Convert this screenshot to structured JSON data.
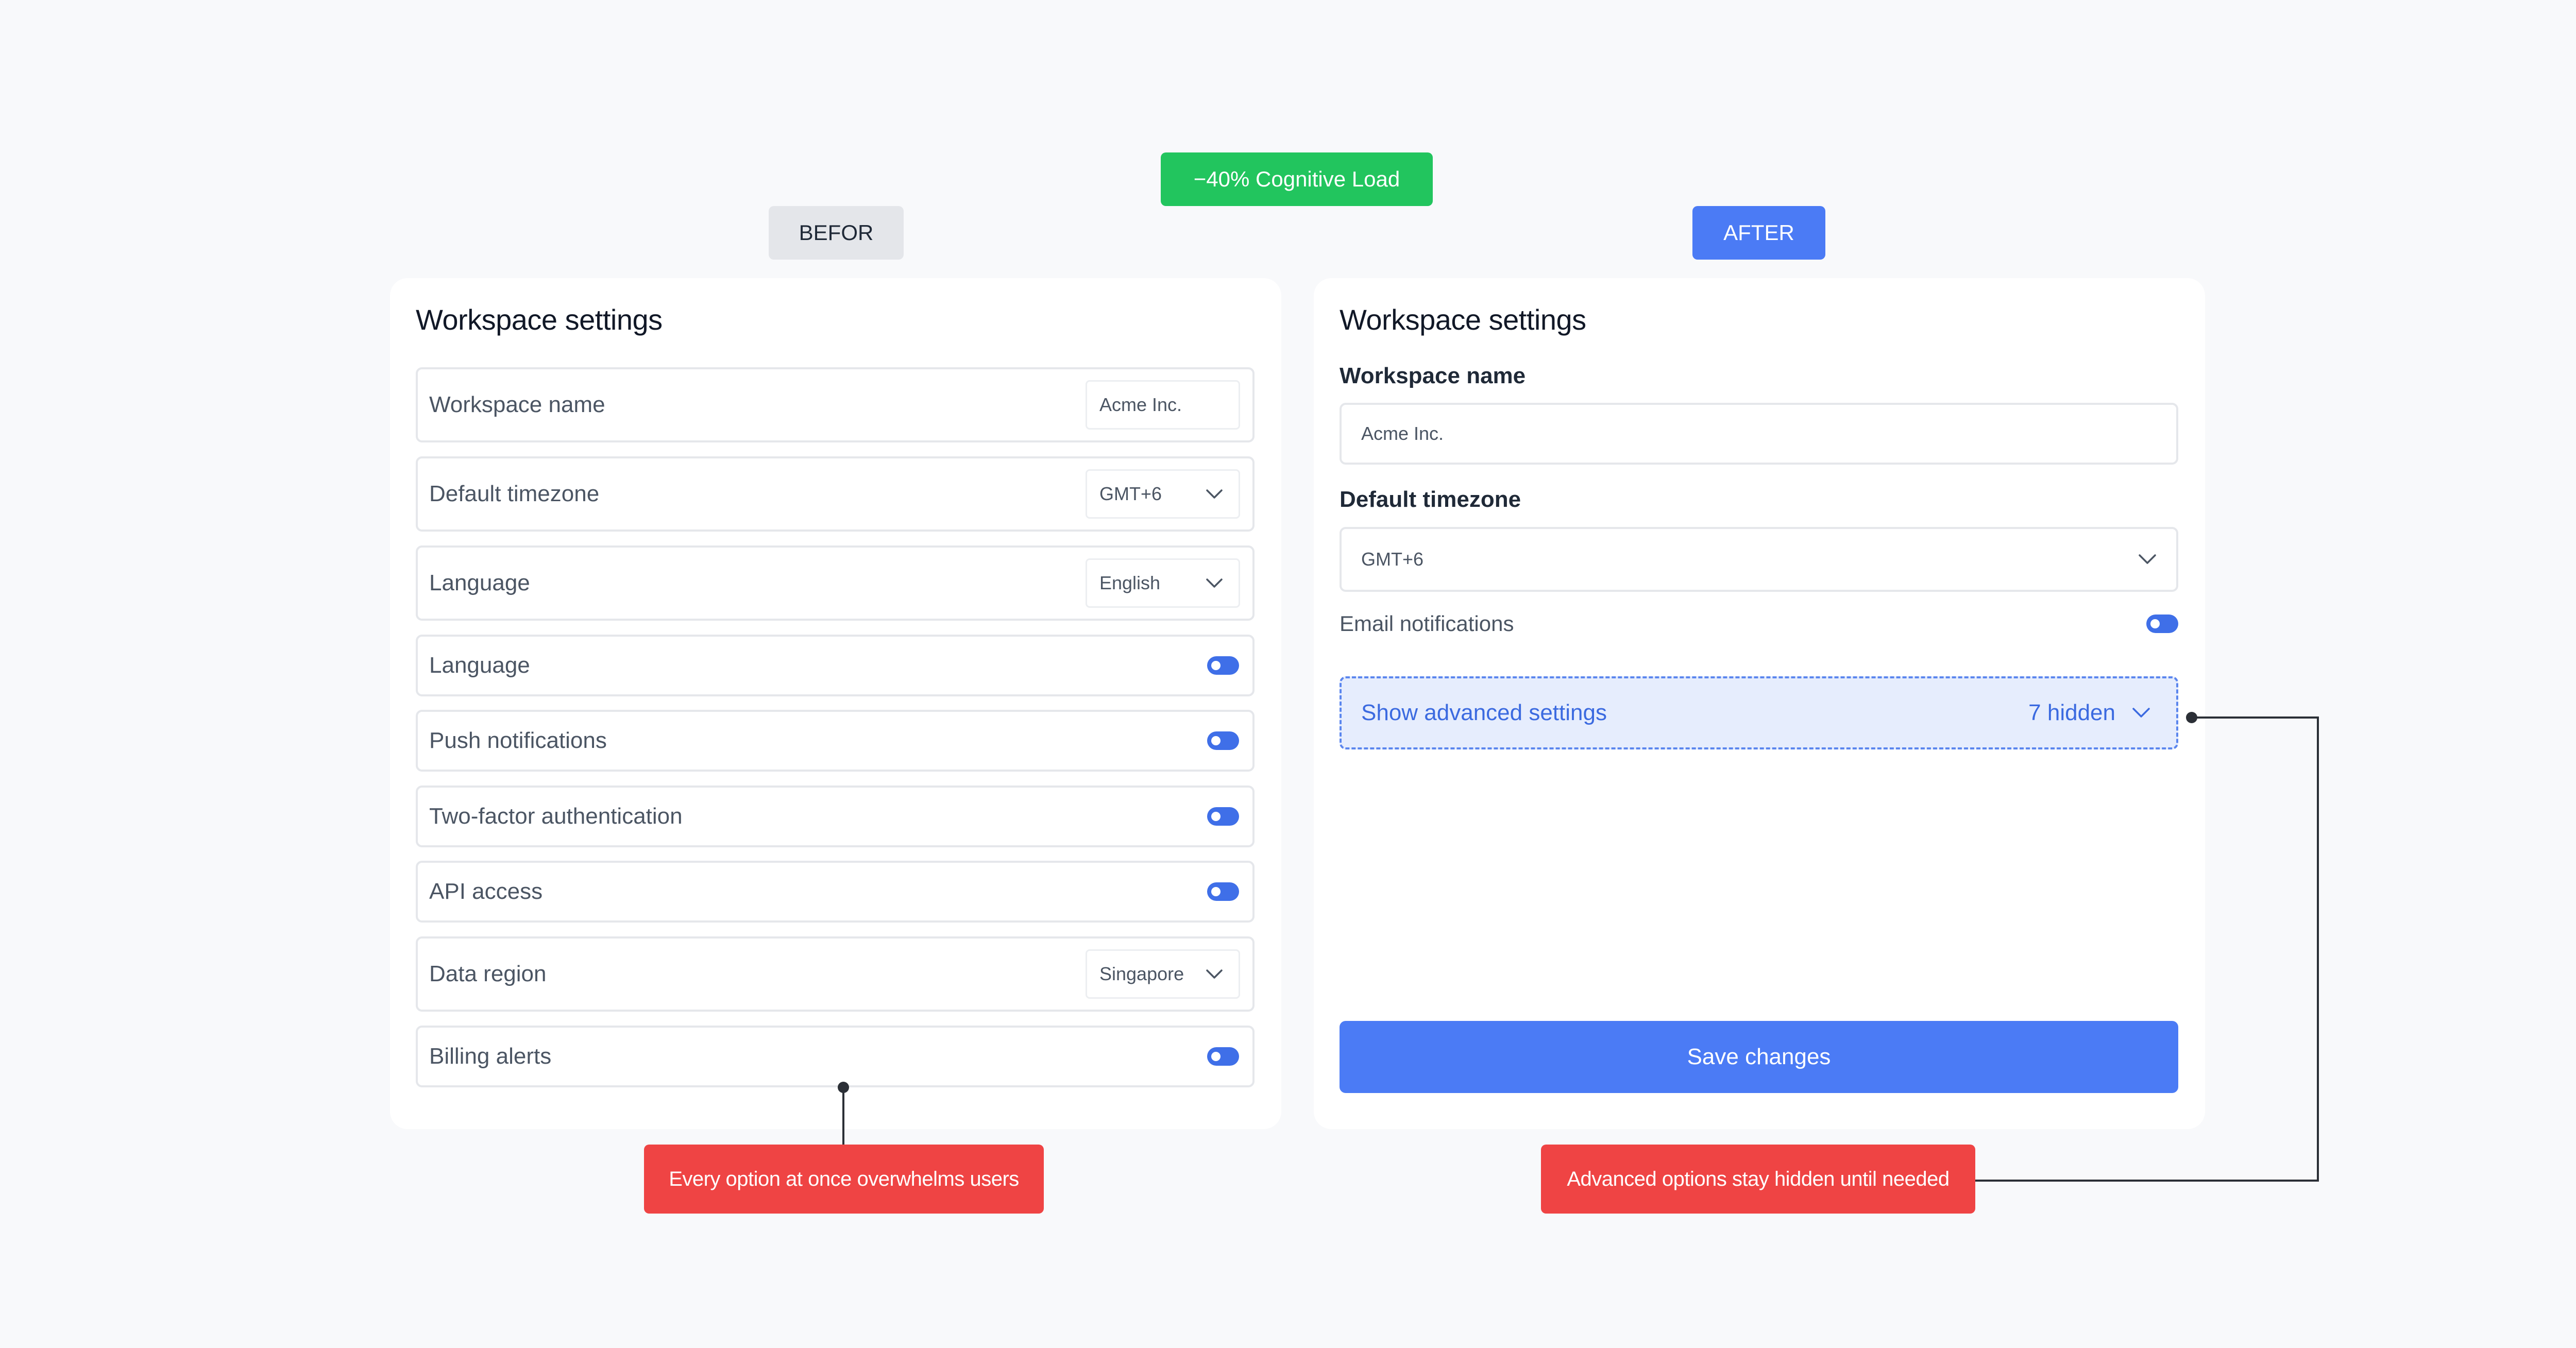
{
  "banner": {
    "improvement_badge": "−40% Cognitive Load",
    "before_label": "BEFOR",
    "after_label": "AFTER"
  },
  "before_panel": {
    "title": "Workspace settings",
    "rows": [
      {
        "label": "Workspace name",
        "control": "text",
        "value": "Acme Inc."
      },
      {
        "label": "Default timezone",
        "control": "select",
        "value": "GMT+6"
      },
      {
        "label": "Language",
        "control": "select",
        "value": "English"
      },
      {
        "label": "Language",
        "control": "toggle",
        "on": true
      },
      {
        "label": "Push notifications",
        "control": "toggle",
        "on": true
      },
      {
        "label": "Two-factor authentication",
        "control": "toggle",
        "on": true
      },
      {
        "label": "API access",
        "control": "toggle",
        "on": true
      },
      {
        "label": "Data region",
        "control": "select",
        "value": "Singapore"
      },
      {
        "label": "Billing alerts",
        "control": "toggle",
        "on": true
      }
    ]
  },
  "after_panel": {
    "title": "Workspace settings",
    "workspace_name": {
      "label": "Workspace name",
      "value": "Acme Inc."
    },
    "default_timezone": {
      "label": "Default timezone",
      "value": "GMT+6"
    },
    "email_notifications": {
      "label": "Email notifications",
      "on": true
    },
    "advanced": {
      "label": "Show advanced settings",
      "count": "7 hidden"
    },
    "save_label": "Save changes"
  },
  "callouts": {
    "before": "Every option at once overwhelms users",
    "after": "Advanced options stay hidden until needed"
  },
  "colors": {
    "accent_blue": "#4b7bf5",
    "success_green": "#22c55e",
    "alert_red": "#ef4444",
    "toggle_on": "#3f6fe8"
  },
  "icons": {
    "select_indicator": "chevron-down-icon",
    "switch": "toggle-switch"
  }
}
